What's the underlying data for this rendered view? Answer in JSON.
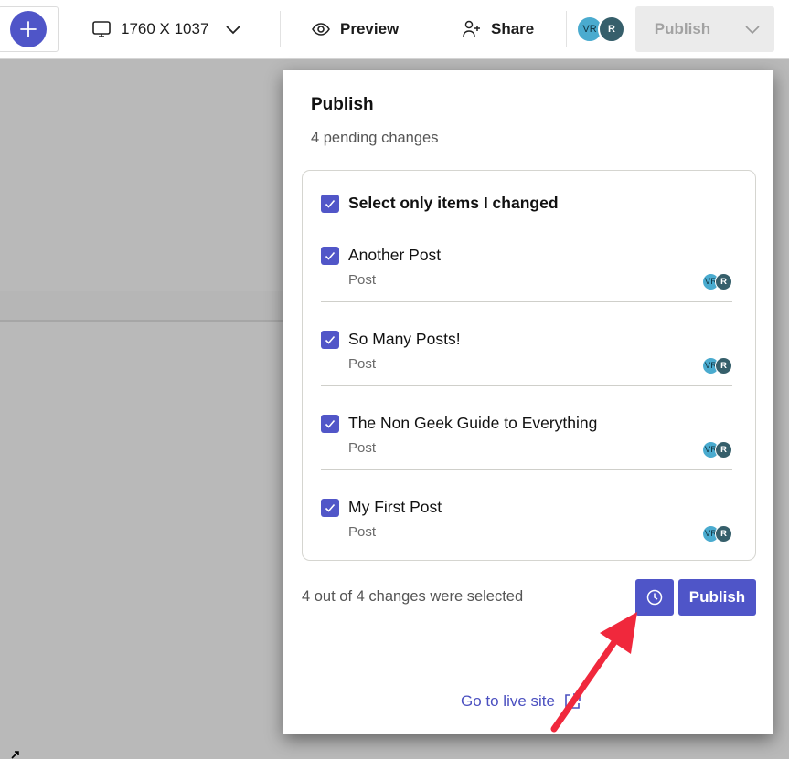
{
  "toolbar": {
    "add_icon": "plus-icon",
    "device_icon": "monitor-icon",
    "resolution": "1760 X 1037",
    "resolution_dropdown_icon": "chevron-down-icon",
    "preview_icon": "eye-icon",
    "preview_label": "Preview",
    "share_icon": "user-plus-icon",
    "share_label": "Share",
    "avatars": [
      "VR",
      "R"
    ],
    "publish_label": "Publish",
    "publish_disabled": true,
    "publish_dropdown_icon": "chevron-down-icon"
  },
  "publish_panel": {
    "title": "Publish",
    "pending": "4 pending changes",
    "select_only_label": "Select only items I changed",
    "select_only_checked": true,
    "items": [
      {
        "title": "Another Post",
        "type": "Post",
        "checked": true,
        "avatars": [
          "VR",
          "R"
        ]
      },
      {
        "title": "So Many Posts!",
        "type": "Post",
        "checked": true,
        "avatars": [
          "VR",
          "R"
        ]
      },
      {
        "title": "The Non Geek Guide to Everything",
        "type": "Post",
        "checked": true,
        "avatars": [
          "VR",
          "R"
        ]
      },
      {
        "title": "My First Post",
        "type": "Post",
        "checked": true,
        "avatars": [
          "VR",
          "R"
        ]
      }
    ],
    "selection_summary": "4 out of 4 changes were selected",
    "schedule_icon": "clock-icon",
    "publish_label": "Publish",
    "live_site_label": "Go to live site",
    "live_site_icon": "external-link-icon"
  },
  "colors": {
    "accent": "#4f55c8",
    "annotation_arrow": "#f0283c",
    "avatar_vr": "#4aabcf",
    "avatar_r": "#365f6b",
    "backdrop": "#b9b9b9"
  }
}
